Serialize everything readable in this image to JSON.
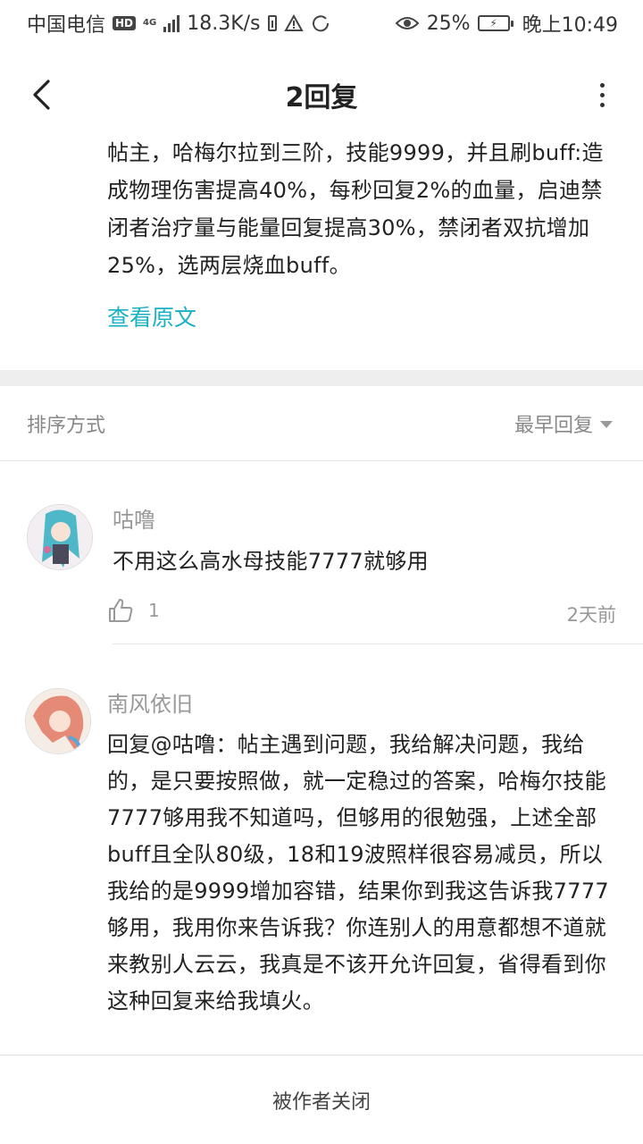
{
  "status_bar": {
    "carrier": "中国电信",
    "hd_badge": "HD",
    "network": "4G",
    "speed": "18.3K/s",
    "battery_percent": "25%",
    "time": "晚上10:49"
  },
  "nav": {
    "title": "2回复"
  },
  "post": {
    "text": "帖主，哈梅尔拉到三阶，技能9999，并且刷buff:造成物理伤害提高40%，每秒回复2%的血量，启迪禁闭者治疗量与能量回复提高30%，禁闭者双抗增加25%，选两层烧血buff。",
    "view_original": "查看原文",
    "link_color": "#1bb1c4"
  },
  "sort": {
    "label": "排序方式",
    "selected": "最早回复"
  },
  "replies": [
    {
      "name": "咕噜",
      "body": "不用这么高水母技能7777就够用",
      "likes": "1",
      "time": "2天前"
    },
    {
      "name": "南风依旧",
      "body": "回复@咕噜：帖主遇到问题，我给解决问题，我给的，是只要按照做，就一定稳过的答案，哈梅尔技能7777够用我不知道吗，但够用的很勉强，上述全部buff且全队80级，18和19波照样很容易减员，所以我给的是9999增加容错，结果你到我这告诉我7777够用，我用你来告诉我？你连别人的用意都想不道就来教别人云云，我真是不该开允许回复，省得看到你这种回复来给我填火。"
    }
  ],
  "footer": {
    "closed_notice": "被作者关闭"
  }
}
